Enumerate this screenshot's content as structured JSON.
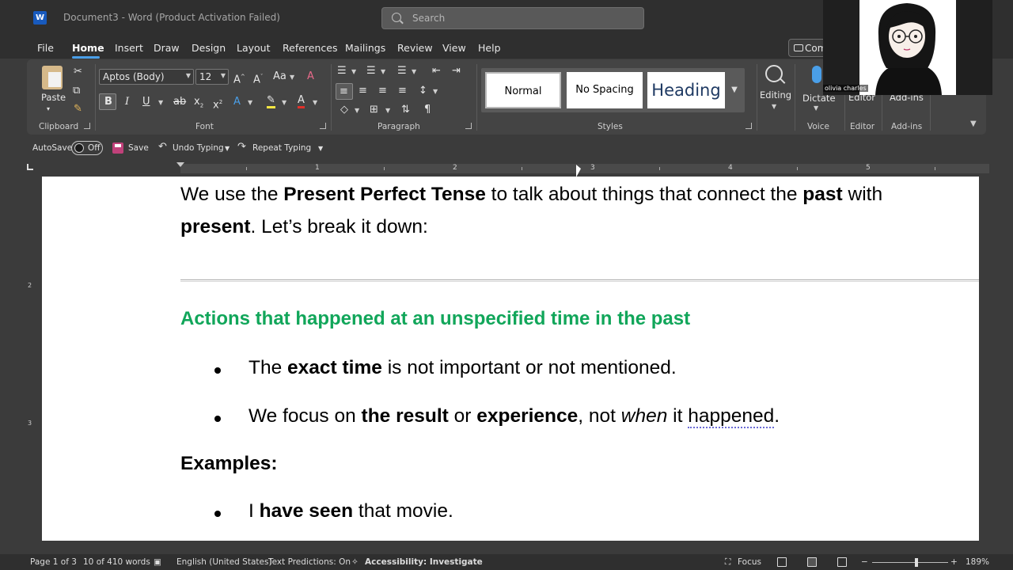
{
  "titlebar": {
    "doc_title": "Document3  -  Word (Product Activation Failed)",
    "search_placeholder": "Search"
  },
  "menu": [
    "File",
    "Home",
    "Insert",
    "Draw",
    "Design",
    "Layout",
    "References",
    "Mailings",
    "Review",
    "View",
    "Help"
  ],
  "comments_label": "Com",
  "ribbon": {
    "clipboard": {
      "paste": "Paste",
      "label": "Clipboard"
    },
    "font": {
      "family": "Aptos (Body)",
      "size": "12",
      "label": "Font"
    },
    "paragraph": {
      "label": "Paragraph"
    },
    "styles": {
      "normal": "Normal",
      "no_spacing": "No Spacing",
      "heading": "Heading",
      "label": "Styles"
    },
    "editing": "Editing",
    "dictate": "Dictate",
    "voice": "Voice",
    "editor_btn": "Editor",
    "editor": "Editor",
    "addins_btn": "Add-ins",
    "addins": "Add-ins"
  },
  "qat": {
    "autosave": "AutoSave",
    "autosave_state": "Off",
    "save": "Save",
    "undo": "Undo Typing",
    "repeat": "Repeat Typing"
  },
  "ruler_numbers": [
    "1",
    "2",
    "3",
    "4",
    "5"
  ],
  "vruler_numbers": [
    "2",
    "3"
  ],
  "document": {
    "intro_a": "We use the ",
    "intro_b": "Present Perfect Tense",
    "intro_c": " to talk about things that connect the ",
    "intro_d": "past",
    "intro_e": " with",
    "intro2_a": "present",
    "intro2_b": ". Let’s break it down:",
    "heading": "Actions that happened at an unspecified time in the past",
    "b1_a": "The ",
    "b1_b": "exact time",
    "b1_c": " is not important or not mentioned.",
    "b2_a": "We focus on ",
    "b2_b": "the result",
    "b2_c": " or ",
    "b2_d": "experience",
    "b2_e": ", not ",
    "b2_f": "when",
    "b2_g": " it ",
    "b2_h": "happened",
    "b2_i": ".",
    "examples": "Examples:",
    "e1_a": "I ",
    "e1_b": "have seen",
    "e1_c": " that movie."
  },
  "statusbar": {
    "page": "Page 1 of 3",
    "words": "10 of 410 words",
    "language": "English (United States)",
    "predictions": "Text Predictions: On",
    "accessibility": "Accessibility: Investigate",
    "focus": "Focus",
    "zoom": "189%"
  },
  "webcam": {
    "name": "olivia charles"
  },
  "colors": {
    "heading_green": "#11a65a",
    "word_blue": "#185abd"
  }
}
